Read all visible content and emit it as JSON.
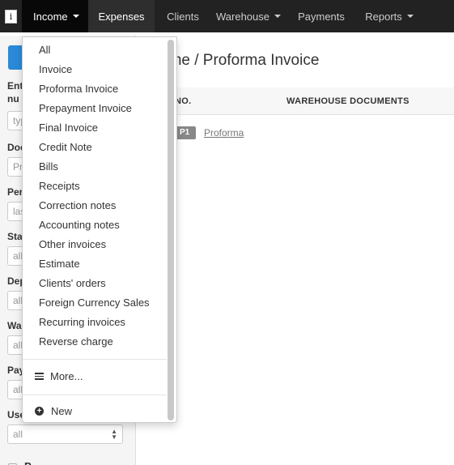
{
  "nav": {
    "logo_glyph": "i",
    "items": [
      {
        "label": "Income"
      },
      {
        "label": "Expenses"
      },
      {
        "label": "Clients"
      },
      {
        "label": "Warehouse"
      },
      {
        "label": "Payments"
      },
      {
        "label": "Reports"
      }
    ]
  },
  "sidebar": {
    "labels": [
      "Ent",
      "nu",
      "Doc",
      "Per",
      "Sta",
      "Dep",
      "Wa",
      "Pay",
      "Use"
    ],
    "fields": [
      "typ",
      "Pr",
      "las",
      "all",
      "all",
      "all",
      "all",
      "all"
    ],
    "partial_text": "P"
  },
  "main": {
    "title": "ome / Proforma Invoice",
    "columns": [
      "NO.",
      "WAREHOUSE DOCUMENTS"
    ],
    "row": {
      "badge": "P1",
      "link": "Proforma"
    }
  },
  "dropdown": {
    "items": [
      "All",
      "Invoice",
      "Proforma Invoice",
      "Prepayment Invoice",
      "Final Invoice",
      "Credit Note",
      "Bills",
      "Receipts",
      "Correction notes",
      "Accounting notes",
      "Other invoices",
      "Estimate",
      "Clients' orders",
      "Foreign Currency Sales",
      "Recurring invoices",
      "Reverse charge"
    ],
    "more_label": "More...",
    "new_label": "New"
  }
}
